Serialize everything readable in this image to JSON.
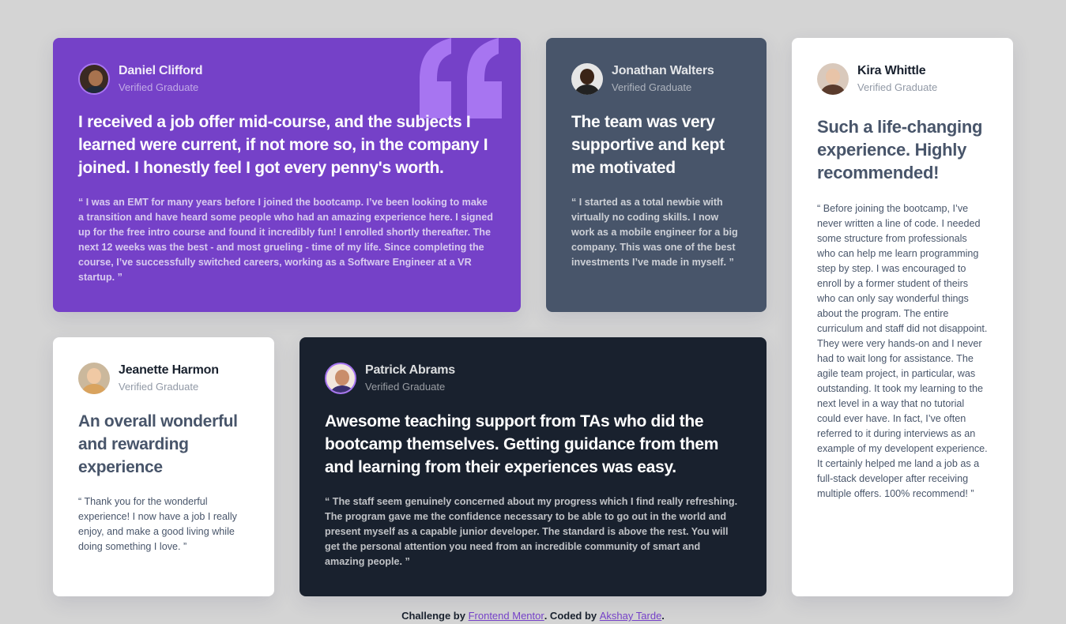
{
  "colors": {
    "page_bg": "#d4d4d4",
    "purple": "#7541c8",
    "grayish_blue": "#48556a",
    "dark_blue": "#19212e",
    "white": "#ffffff",
    "quote_mark": "#a775f1"
  },
  "testimonials": [
    {
      "name": "Daniel Clifford",
      "role": "Verified Graduate",
      "heading": "I received a job offer mid-course, and the subjects I learned were current, if not more so, in the company I joined. I honestly feel I got every penny's worth.",
      "body": "“ I was an EMT for many years before I joined the bootcamp. I’ve been looking to make a transition and have heard some people who had an amazing experience here. I signed up for the free intro course and found it incredibly fun! I enrolled shortly thereafter. The next 12 weeks was the best - and most grueling - time of my life. Since completing the course, I’ve successfully switched careers, working as a Software Engineer at a VR startup. ”",
      "icon": "quote-icon"
    },
    {
      "name": "Jonathan Walters",
      "role": "Verified Graduate",
      "heading": "The team was very supportive and kept me motivated",
      "body": "“ I started as a total newbie with virtually no coding skills. I now work as a mobile engineer for a big company. This was one of the best investments I’ve made in myself. ”"
    },
    {
      "name": "Kira Whittle",
      "role": "Verified Graduate",
      "heading": "Such a life-changing experience. Highly recommended!",
      "body": "“ Before joining the bootcamp, I’ve never written a line of code. I needed some structure from professionals who can help me learn programming step by step. I was encouraged to enroll by a former student of theirs who can only say wonderful things about the program. The entire curriculum and staff did not disappoint. They were very hands-on and I never had to wait long for assistance. The agile team project, in particular, was outstanding. It took my learning to the next level in a way that no tutorial could ever have. In fact, I’ve often referred to it during interviews as an example of my developent experience. It certainly helped me land a job as a full-stack developer after receiving multiple offers. 100% recommend! ”"
    },
    {
      "name": "Jeanette Harmon",
      "role": "Verified Graduate",
      "heading": "An overall wonderful and rewarding experience",
      "body": "“ Thank you for the wonderful experience! I now have a job I really enjoy, and make a good living while doing something I love. ”"
    },
    {
      "name": "Patrick Abrams",
      "role": "Verified Graduate",
      "heading": "Awesome teaching support from TAs who did the bootcamp themselves. Getting guidance from them and learning from their experiences was easy.",
      "body": "“ The staff seem genuinely concerned about my progress which I find really refreshing. The program gave me the confidence necessary to be able to go out in the world and present myself as a capable junior developer. The standard is above the rest. You will get the personal attention you need from an incredible community of smart and amazing people. ”"
    }
  ],
  "attribution": {
    "prefix": "Challenge by ",
    "link1": "Frontend Mentor",
    "middle": ". Coded by ",
    "link2": "Akshay Tarde",
    "suffix": "."
  }
}
